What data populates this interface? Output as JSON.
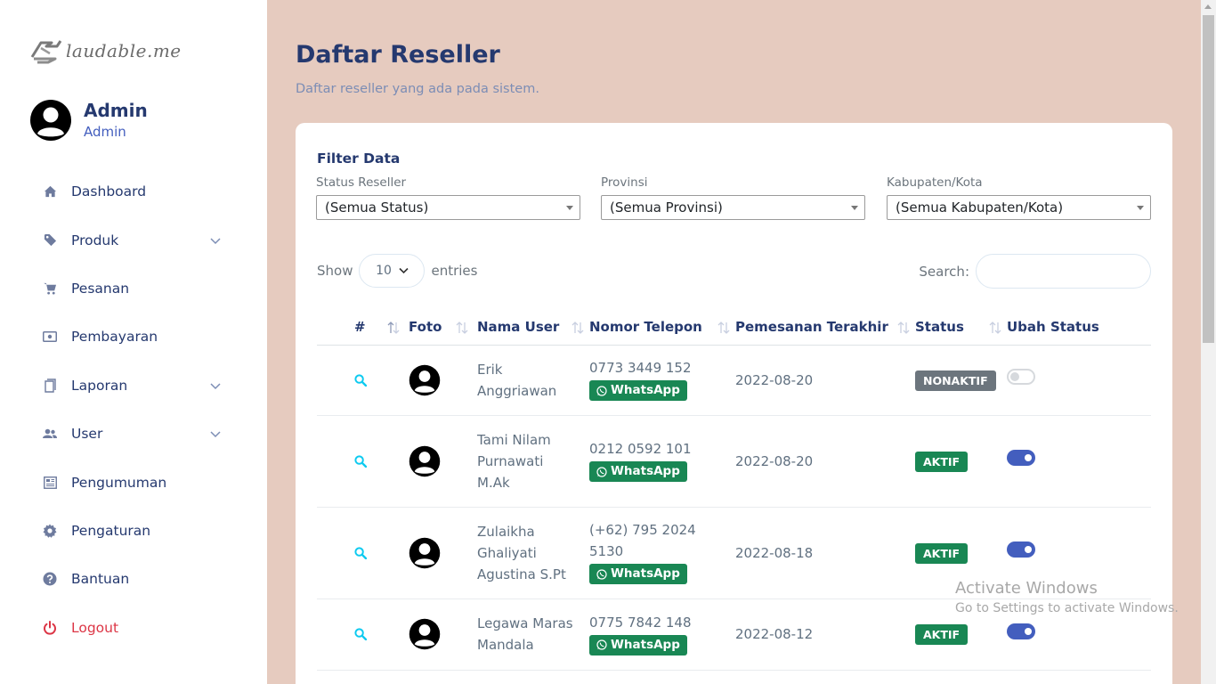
{
  "brand": {
    "logo_text": "laudable.me"
  },
  "profile": {
    "name": "Admin",
    "role": "Admin"
  },
  "menu": [
    {
      "label": "Dashboard",
      "icon": "home-icon"
    },
    {
      "label": "Produk",
      "icon": "tag-icon",
      "expandable": true
    },
    {
      "label": "Pesanan",
      "icon": "cart-icon"
    },
    {
      "label": "Pembayaran",
      "icon": "cash-icon"
    },
    {
      "label": "Laporan",
      "icon": "file-icon",
      "expandable": true
    },
    {
      "label": "User",
      "icon": "users-icon",
      "expandable": true
    },
    {
      "label": "Pengumuman",
      "icon": "newspaper-icon"
    },
    {
      "label": "Pengaturan",
      "icon": "gear-icon"
    },
    {
      "label": "Bantuan",
      "icon": "help-icon"
    },
    {
      "label": "Logout",
      "icon": "power-icon"
    }
  ],
  "page": {
    "title": "Daftar Reseller",
    "subtitle": "Daftar reseller yang ada pada sistem."
  },
  "filter": {
    "title": "Filter Data",
    "status": {
      "label": "Status Reseller",
      "value": "(Semua Status)"
    },
    "provinsi": {
      "label": "Provinsi",
      "value": "(Semua Provinsi)"
    },
    "kabupaten": {
      "label": "Kabupaten/Kota",
      "value": "(Semua Kabupaten/Kota)"
    }
  },
  "datatable": {
    "show_label": "Show",
    "length_value": "10",
    "entries_label": "entries",
    "search_label": "Search:"
  },
  "table": {
    "headers": [
      "#",
      "Foto",
      "Nama User",
      "Nomor Telepon",
      "Pemesanan Terakhir",
      "Status",
      "Ubah Status"
    ],
    "whatsapp_label": "WhatsApp",
    "rows": [
      {
        "name_lines": [
          "Erik",
          "Anggriawan"
        ],
        "phone_lines": [
          "0773 3449 152"
        ],
        "last_order": "2022-08-20",
        "status": "NONAKTIF",
        "active": false
      },
      {
        "name_lines": [
          "Tami Nilam",
          "Purnawati",
          "M.Ak"
        ],
        "phone_lines": [
          "0212 0592 101"
        ],
        "last_order": "2022-08-20",
        "status": "AKTIF",
        "active": true
      },
      {
        "name_lines": [
          "Zulaikha",
          "Ghaliyati",
          "Agustina S.Pt"
        ],
        "phone_lines": [
          "(+62) 795 2024",
          "5130"
        ],
        "last_order": "2022-08-18",
        "status": "AKTIF",
        "active": true
      },
      {
        "name_lines": [
          "Legawa Maras",
          "Mandala"
        ],
        "phone_lines": [
          "0775 7842 148"
        ],
        "last_order": "2022-08-12",
        "status": "AKTIF",
        "active": true
      }
    ]
  },
  "watermark": {
    "title": "Activate Windows",
    "subtitle": "Go to Settings to activate Windows."
  },
  "colors": {
    "background": "#e6cbbf",
    "primary": "#435ebe",
    "heading": "#25396f",
    "success": "#198754",
    "secondary": "#6c757d",
    "danger": "#dc3545",
    "search_icon": "#0dcaf0"
  }
}
